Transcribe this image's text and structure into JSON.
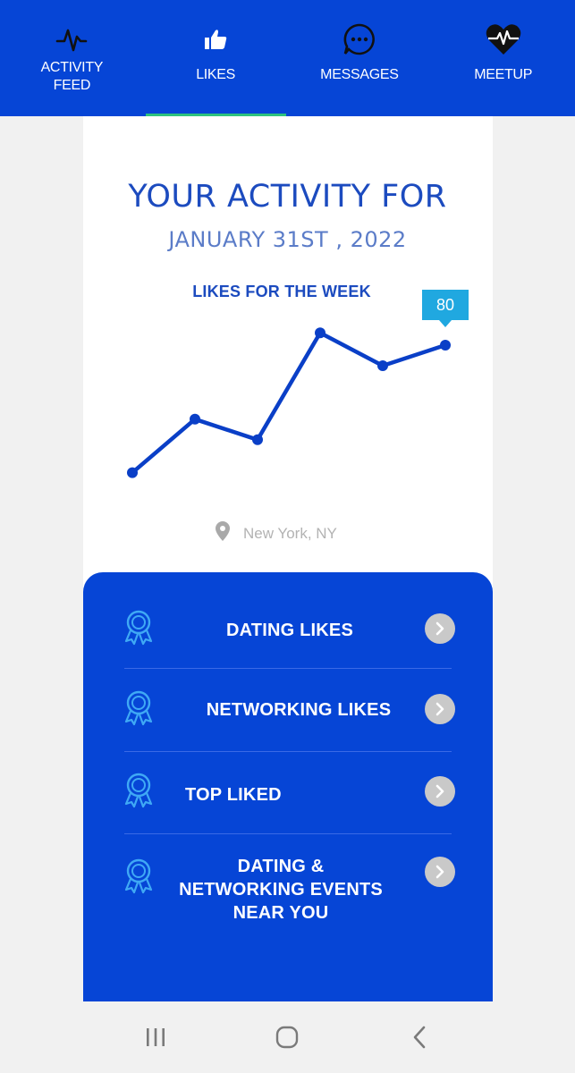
{
  "nav": {
    "items": [
      {
        "label_line1": "ACTIVITY",
        "label_line2": "FEED",
        "icon": "activity-pulse-icon"
      },
      {
        "label": "LIKES",
        "icon": "thumbs-up-icon"
      },
      {
        "label": "MESSAGES",
        "icon": "chat-bubble-icon"
      },
      {
        "label": "MEETUP",
        "icon": "heart-pulse-icon"
      }
    ],
    "active": "LIKES"
  },
  "header": {
    "title": "YOUR ACTIVITY FOR",
    "date": "JANUARY 31ST , 2022"
  },
  "chart_data": {
    "type": "line",
    "title": "LIKES FOR THE WEEK",
    "xlabel": "",
    "ylabel": "",
    "x": [
      1,
      2,
      3,
      4,
      5,
      6
    ],
    "series": [
      {
        "values": [
          18,
          44,
          34,
          86,
          70,
          80
        ]
      }
    ],
    "ylim": [
      0,
      100
    ],
    "grid": false,
    "tooltip": {
      "point_index": 5,
      "label": "80"
    },
    "line_color": "#0a3fc7"
  },
  "location": {
    "text": "New York, NY",
    "icon": "map-pin-icon"
  },
  "menu": {
    "items": [
      {
        "label": "DATING LIKES",
        "icon": "award-ribbon-icon"
      },
      {
        "label": "NETWORKING LIKES",
        "icon": "award-ribbon-icon"
      },
      {
        "label": "TOP LIKED",
        "icon": "award-ribbon-icon"
      },
      {
        "label_line1": "DATING &",
        "label_line2": "NETWORKING EVENTS",
        "label_line3": "NEAR YOU",
        "icon": "award-ribbon-icon"
      }
    ]
  },
  "colors": {
    "brand_blue": "#0645d6",
    "title_blue": "#1c4bbf",
    "tooltip_cyan": "#20a8e0",
    "active_underline": "#2ec27e"
  }
}
